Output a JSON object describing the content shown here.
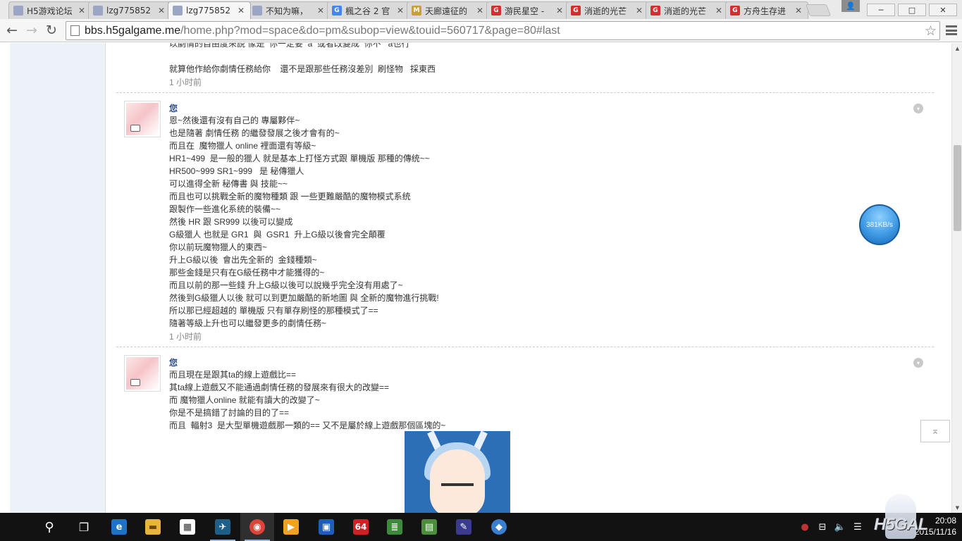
{
  "browser": {
    "tabs": [
      {
        "label": "H5游戏论坛",
        "favicon_color": "#9aa6c4",
        "favicon_text": ""
      },
      {
        "label": "lzg775852",
        "favicon_color": "#9aa6c4",
        "favicon_text": ""
      },
      {
        "label": "lzg775852",
        "favicon_color": "#9aa6c4",
        "favicon_text": "",
        "active": true
      },
      {
        "label": "不知为嘛，",
        "favicon_color": "#9aa6c4",
        "favicon_text": ""
      },
      {
        "label": "楓之谷 2 官",
        "favicon_color": "#4285f4",
        "favicon_text": "G"
      },
      {
        "label": "天廊遠征的",
        "favicon_color": "#c8a03a",
        "favicon_text": "M"
      },
      {
        "label": "游民星空 -",
        "favicon_color": "#d32f2f",
        "favicon_text": "G"
      },
      {
        "label": "消逝的光芒",
        "favicon_color": "#d32f2f",
        "favicon_text": "G"
      },
      {
        "label": "消逝的光芒",
        "favicon_color": "#d32f2f",
        "favicon_text": "G"
      },
      {
        "label": "方舟生存进",
        "favicon_color": "#d32f2f",
        "favicon_text": "G"
      }
    ],
    "window_controls": {
      "minimize": "─",
      "maximize": "□",
      "close": "✕"
    },
    "url_host": "bbs.h5galgame.me",
    "url_path": "/home.php?mod=space&do=pm&subop=view&touid=560717&page=80#last",
    "icons": {
      "back": "←",
      "forward": "→",
      "reload": "↻",
      "star": "☆"
    }
  },
  "thread": {
    "top_partial": {
      "lines": [
        "以劇情的自由度來說 像是  你一定要  a  或者改變成  你不   a也行",
        "",
        "就算他作給你劇情任務給你    還不是跟那些任務沒差別  刷怪物   採東西"
      ],
      "timestamp": "1 小时前"
    },
    "messages": [
      {
        "author": "您",
        "lines": [
          "恩~然後還有沒有自己的 專屬夥伴~",
          "也是隨著 劇情任務 的繼發發展之後才會有的~",
          "而且在  魔物獵人 online 裡面還有等級~",
          "HR1~499  是一般的獵人 就是基本上打怪方式跟 單機版 那種的傳统~~",
          "HR500~999 SR1~999   是 秘傳獵人",
          "可以進得全新 秘傳書 與 技能~~",
          "而且也可以挑戰全新的魔物種類 跟 一些更難嚴酷的魔物模式系统",
          "跟製作一些進化系统的裝備~~",
          "然後 HR 跟 SR999 以後可以變成",
          "G級獵人 也就是 GR1  與  GSR1  升上G級以後會完全顛覆",
          "你以前玩魔物獵人的東西~",
          "升上G級以後  會出先全新的  金錢種類~",
          "那些金錢是只有在G級任務中才能獲得的~",
          "而且以前的那一些錢 升上G級以後可以說幾乎完全沒有用處了~",
          "然後到G級獵人以後 就可以到更加嚴酷的新地圖 與 全新的魔物進行挑戰!",
          "所以那已經超越的 單機版 只有單存刷怪的那種模式了==",
          "隨著等級上升也可以繼發更多的劇情任務~"
        ],
        "timestamp": "1 小时前"
      },
      {
        "author": "您",
        "lines": [
          "而且現在是跟其ta的線上遊戲比==",
          "其ta線上遊戲又不能通過劇情任務的發展來有很大的改變==",
          "而 魔物獵人online 就能有讀大的改變了~",
          "你是不是搞錯了討論的目的了==",
          "而且  輻射3  是大型單機遊戲那一類的== 又不是屬於線上遊戲那個區塊的~"
        ],
        "timestamp": ""
      }
    ],
    "collapse_icon": "▾"
  },
  "widgets": {
    "speed": "381KB/s",
    "back_to_top": "⌅"
  },
  "taskbar": {
    "items": [
      {
        "name": "search-icon",
        "glyph": "⚲",
        "bg": "transparent"
      },
      {
        "name": "task-view-icon",
        "glyph": "❐",
        "bg": "transparent"
      },
      {
        "name": "edge-icon",
        "glyph": "e",
        "bg": "#1e73c8"
      },
      {
        "name": "file-explorer-icon",
        "glyph": "▬",
        "bg": "#e6b53a"
      },
      {
        "name": "store-icon",
        "glyph": "▦",
        "bg": "#ffffff"
      },
      {
        "name": "app-bird-icon",
        "glyph": "✈",
        "bg": "#1f5e86"
      },
      {
        "name": "chrome-icon",
        "glyph": "◉",
        "bg": "#db4437"
      },
      {
        "name": "video-player-icon",
        "glyph": "▶",
        "bg": "#f0a11d"
      },
      {
        "name": "window-app-icon",
        "glyph": "▣",
        "bg": "#1e5db8"
      },
      {
        "name": "app-64-icon",
        "glyph": "64",
        "bg": "#d11f26"
      },
      {
        "name": "books-icon",
        "glyph": "≣",
        "bg": "#3d8a3a"
      },
      {
        "name": "gpu-tool-icon",
        "glyph": "▤",
        "bg": "#4e8c3e"
      },
      {
        "name": "editor-icon",
        "glyph": "✎",
        "bg": "#3b3b8e"
      },
      {
        "name": "media-app-icon",
        "glyph": "◆",
        "bg": "#3a7ecf"
      }
    ],
    "tray": {
      "record": "●",
      "network": "⊟",
      "volume": "🔈",
      "notifications": "☰"
    },
    "time": "20:08",
    "date": "2015/11/16",
    "mascot_logo": "H5GAL"
  }
}
